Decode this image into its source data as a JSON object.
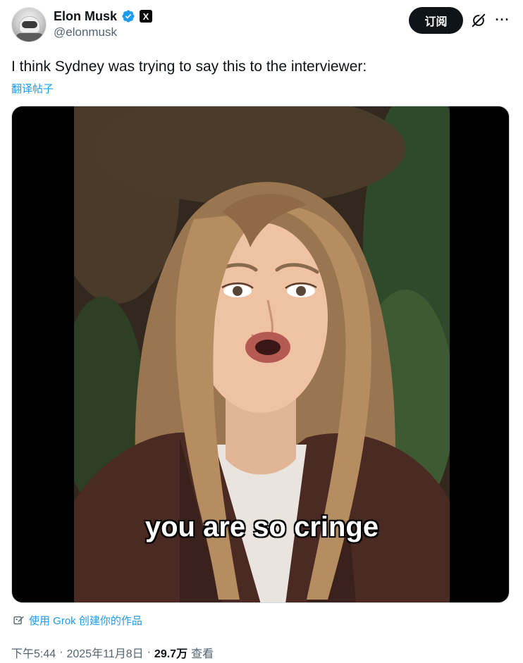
{
  "author": {
    "display_name": "Elon Musk",
    "handle": "@elonmusk",
    "verified_badge": "verified-check-icon",
    "affiliate_badge": "X"
  },
  "actions": {
    "subscribe_label": "订阅",
    "grok_icon": "grok-icon",
    "more_label": "···"
  },
  "tweet": {
    "text": "I think Sydney was trying to say this to the interviewer:",
    "translate_label": "翻译帖子"
  },
  "media": {
    "caption": "you are so cringe"
  },
  "grok": {
    "label": "使用 Grok 创建你的作品"
  },
  "meta": {
    "time": "下午5:44",
    "separator": "·",
    "date": "2025年11月8日",
    "views_count": "29.7万",
    "views_label": "查看"
  },
  "colors": {
    "link": "#1d9bf0",
    "text": "#0f1419",
    "muted": "#536471",
    "button_bg": "#0f1419"
  }
}
